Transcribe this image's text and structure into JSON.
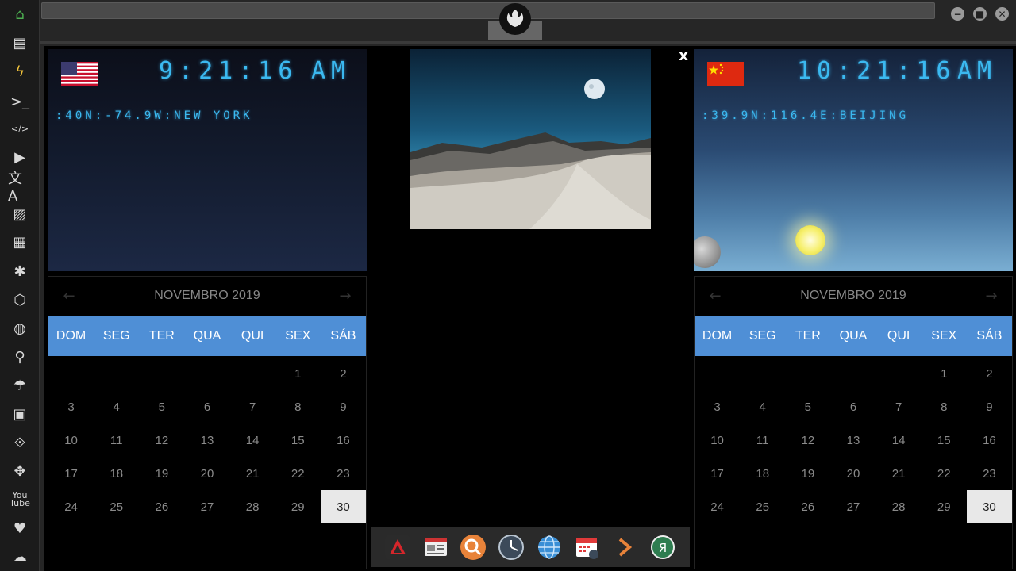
{
  "window": {
    "minimize_glyph": "−",
    "maximize_glyph": "■",
    "close_glyph": "✕"
  },
  "sidebar": {
    "items": [
      {
        "name": "home-icon",
        "glyph": "⌂",
        "color": "#4caf50"
      },
      {
        "name": "document-icon",
        "glyph": "▤"
      },
      {
        "name": "lightning-icon",
        "glyph": "ϟ",
        "color": "#f0c23a"
      },
      {
        "name": "terminal-icon",
        "glyph": ">_"
      },
      {
        "name": "code-icon",
        "glyph": "</>"
      },
      {
        "name": "play-icon",
        "glyph": "▶"
      },
      {
        "name": "translate-icon",
        "glyph": "文A"
      },
      {
        "name": "image-icon",
        "glyph": "▨"
      },
      {
        "name": "news-icon",
        "glyph": "▦"
      },
      {
        "name": "empire-icon",
        "glyph": "✱"
      },
      {
        "name": "hexagon-icon",
        "glyph": "⬡"
      },
      {
        "name": "globe-icon",
        "glyph": "◍"
      },
      {
        "name": "search-icon",
        "glyph": "⚲"
      },
      {
        "name": "umbrella-icon",
        "glyph": "☂"
      },
      {
        "name": "contacts-icon",
        "glyph": "▣"
      },
      {
        "name": "link-icon",
        "glyph": "⟐"
      },
      {
        "name": "expand-icon",
        "glyph": "✥"
      },
      {
        "name": "youtube-icon",
        "glyph": "You\nTube"
      },
      {
        "name": "heart-icon",
        "glyph": "♥"
      },
      {
        "name": "cloud-icon",
        "glyph": "☁"
      }
    ]
  },
  "clocks": {
    "new_york": {
      "time": "9:21:16",
      "ampm": "AM",
      "location": ":40N:-74.9W:NEW YORK",
      "flag": "us-flag"
    },
    "beijing": {
      "time": "10:21:16",
      "ampm": "AM",
      "location": ":39.9N:116.4E:BEIJING",
      "flag": "cn-flag"
    }
  },
  "close_label": "x",
  "calendar": {
    "month_label": "NOVEMBRO 2019",
    "prev_glyph": "←",
    "next_glyph": "→",
    "weekdays": [
      "DOM",
      "SEG",
      "TER",
      "QUA",
      "QUI",
      "SEX",
      "SÁB"
    ],
    "leading_blanks": 5,
    "days": [
      "1",
      "2",
      "3",
      "4",
      "5",
      "6",
      "7",
      "8",
      "9",
      "10",
      "11",
      "12",
      "13",
      "14",
      "15",
      "16",
      "17",
      "18",
      "19",
      "20",
      "21",
      "22",
      "23",
      "24",
      "25",
      "26",
      "27",
      "28",
      "29",
      "30"
    ],
    "today": "30"
  },
  "dock": {
    "items": [
      "arch-icon",
      "news-reader-icon",
      "search-app-icon",
      "clock-app-icon",
      "browser-globe-icon",
      "calendar-app-icon",
      "forward-arrow-icon",
      "yandex-icon"
    ]
  }
}
